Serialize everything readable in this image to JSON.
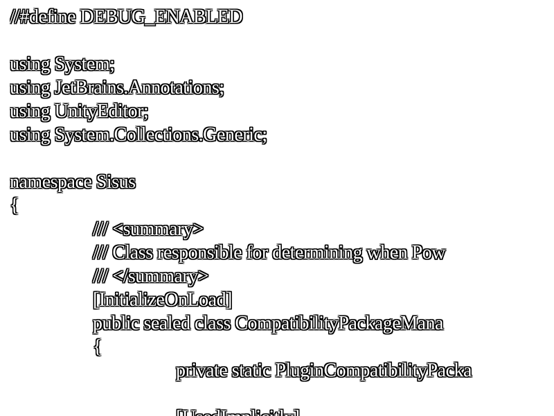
{
  "code": {
    "lines": [
      "//#define DEBUG_ENABLED",
      "",
      "using System;",
      "using JetBrains.Annotations;",
      "using UnityEditor;",
      "using System.Collections.Generic;",
      "",
      "namespace Sisus",
      "{",
      "/// <summary>",
      "/// Class responsible for determining when Pow",
      "/// </summary>",
      "[InitializeOnLoad]",
      "public sealed class CompatibilityPackageMana",
      "{",
      "private static PluginCompatibilityPacka",
      "",
      "[UsedImplicitly]"
    ]
  }
}
